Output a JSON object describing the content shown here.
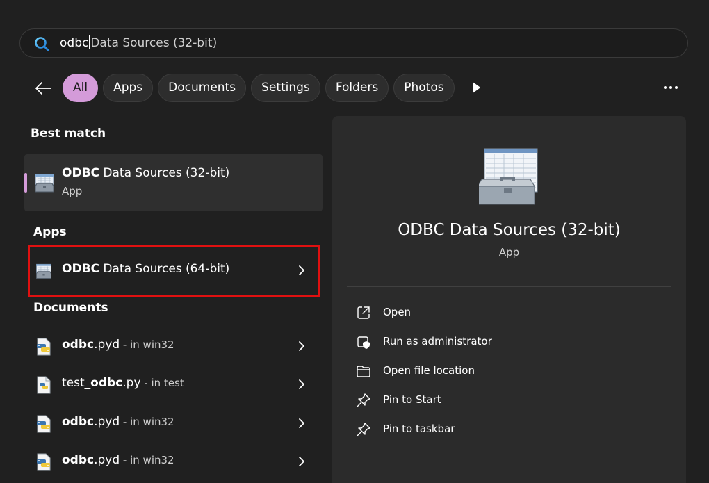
{
  "search": {
    "typed": "odbc",
    "suggestion": "Data Sources (32-bit)"
  },
  "filters": [
    "All",
    "Apps",
    "Documents",
    "Settings",
    "Folders",
    "Photos"
  ],
  "left": {
    "best_match_title": "Best match",
    "best_match": {
      "name_bold": "ODBC",
      "name_rest": " Data Sources (32-bit)",
      "sub": "App"
    },
    "apps_title": "Apps",
    "apps": [
      {
        "name_bold": "ODBC",
        "name_rest": " Data Sources (64-bit)"
      }
    ],
    "documents_title": "Documents",
    "documents": [
      {
        "name_bold": "odbc",
        "name_rest": ".pyd",
        "loc": " - in win32",
        "icon": "python-file-icon"
      },
      {
        "name_pre": "test_",
        "name_bold": "odbc",
        "name_rest": ".py",
        "loc": " - in test",
        "icon": "python-script-icon"
      },
      {
        "name_bold": "odbc",
        "name_rest": ".pyd",
        "loc": " - in win32",
        "icon": "python-file-icon"
      },
      {
        "name_bold": "odbc",
        "name_rest": ".pyd",
        "loc": " - in win32",
        "icon": "python-file-icon"
      }
    ]
  },
  "preview": {
    "title": "ODBC Data Sources (32-bit)",
    "sub": "App",
    "actions": [
      "Open",
      "Run as administrator",
      "Open file location",
      "Pin to Start",
      "Pin to taskbar"
    ]
  },
  "colors": {
    "accent": "#d49bd9",
    "highlight": "#e01010",
    "background": "#202020"
  }
}
